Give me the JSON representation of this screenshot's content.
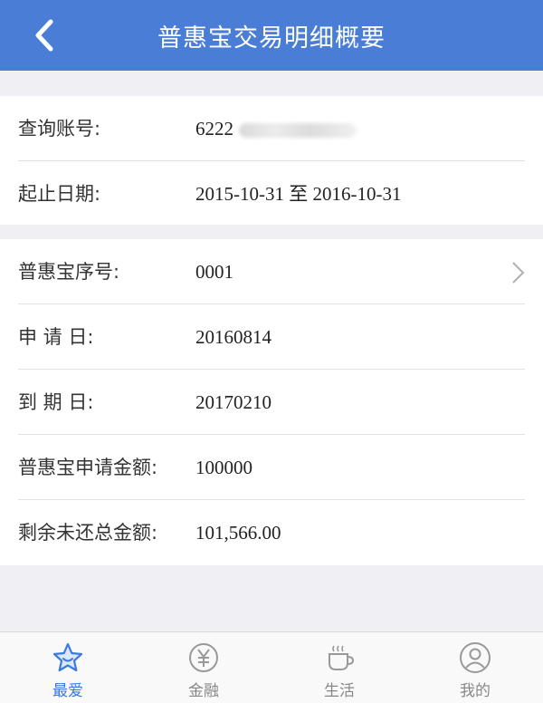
{
  "header": {
    "title": "普惠宝交易明细概要"
  },
  "account": [
    {
      "label": "查询账号:",
      "value": "6222"
    },
    {
      "label": "起止日期:",
      "value": "2015-10-31 至 2016-10-31"
    }
  ],
  "details": [
    {
      "label": "普惠宝序号:",
      "value": "0001"
    },
    {
      "label": "申 请 日:",
      "value": "20160814"
    },
    {
      "label": "到 期 日:",
      "value": "20170210"
    },
    {
      "label": "普惠宝申请金额:",
      "value": "100000"
    },
    {
      "label": "剩余未还总金额:",
      "value": "101,566.00"
    }
  ],
  "tabs": [
    {
      "label": "最爱",
      "icon": "star-icon",
      "active": true
    },
    {
      "label": "金融",
      "icon": "yen-icon",
      "active": false
    },
    {
      "label": "生活",
      "icon": "cup-icon",
      "active": false
    },
    {
      "label": "我的",
      "icon": "user-icon",
      "active": false
    }
  ],
  "colors": {
    "header": "#4a7dd6",
    "accent": "#3a7ae0"
  }
}
